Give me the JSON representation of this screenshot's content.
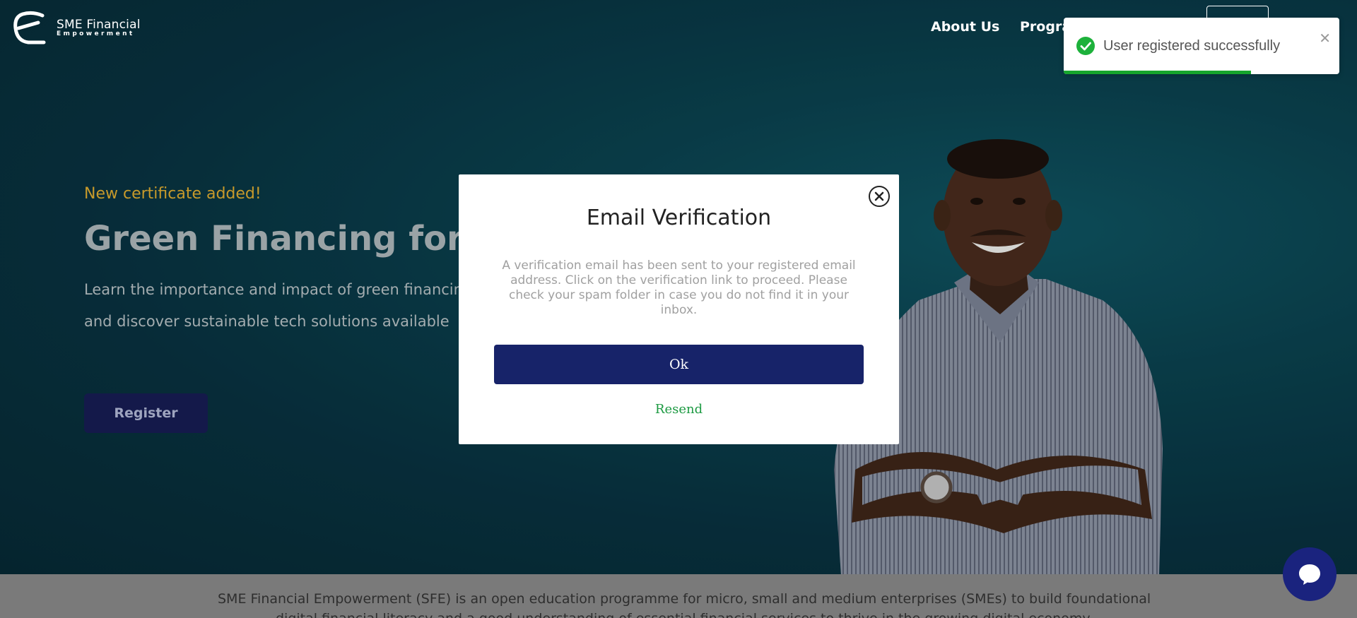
{
  "brand": {
    "title": "SME Financial",
    "subtitle": "Empowerment"
  },
  "nav": {
    "about": "About Us",
    "programmes": "Progra"
  },
  "hero": {
    "eyebrow": "New certificate added!",
    "headline": "Green Financing for SMEs",
    "lead_line1": "Learn the importance and impact of green financing",
    "lead_line2": "and discover sustainable tech solutions available",
    "register": "Register"
  },
  "intro": {
    "line1": "SME Financial Empowerment (SFE) is an open education programme for micro, small and medium enterprises (SMEs) to build foundational",
    "line2": "digital financial literacy and a good understanding of essential financial services to thrive in the growing digital economy."
  },
  "modal": {
    "title": "Email Verification",
    "body": "A verification email has been sent to your registered email address. Click on the verification link to proceed. Please check your spam folder in case you do not find it in your inbox.",
    "ok": "Ok",
    "resend": "Resend"
  },
  "toast": {
    "message": "User registered successfully",
    "progress_fraction": 0.68
  },
  "colors": {
    "hero_bg": "#0b4350",
    "accent_gold": "#c79a2b",
    "primary_navy": "#172369",
    "success_green": "#1db13b",
    "resend_green": "#1c9a42"
  },
  "icons": {
    "modal_close": "circle-x-icon",
    "toast_success": "check-circle-icon",
    "toast_close": "close-icon",
    "chat": "chat-bubble-icon"
  }
}
